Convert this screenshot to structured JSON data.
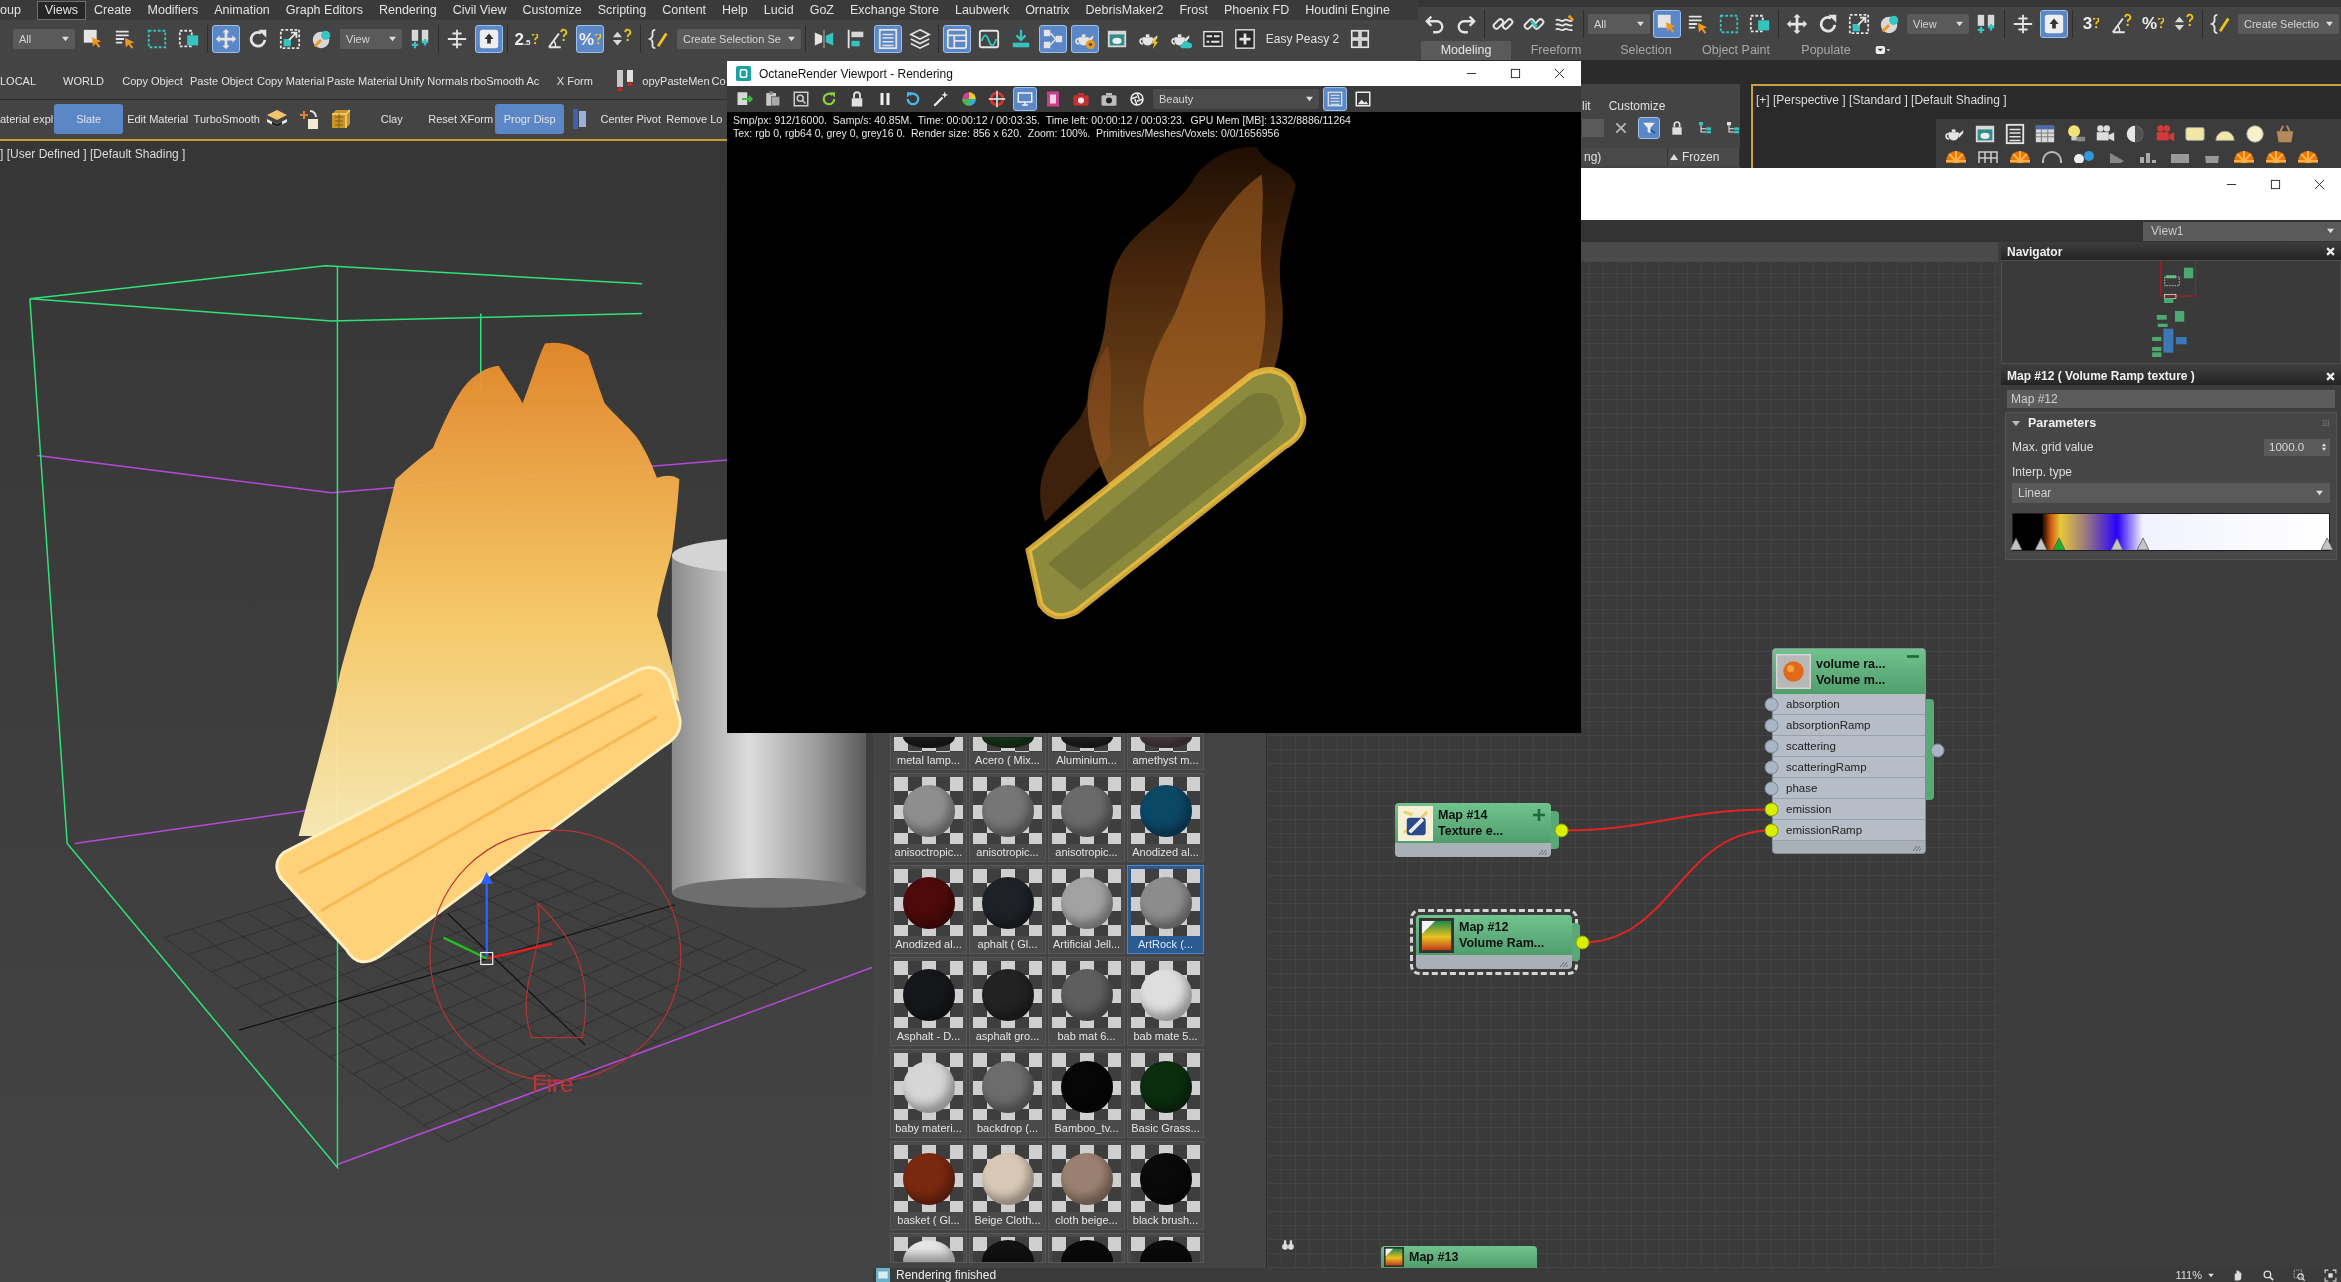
{
  "main_window": {
    "menu": [
      {
        "label": "oup",
        "selected": false
      },
      {
        "label": "Views",
        "selected": true
      },
      {
        "label": "Create",
        "selected": false
      },
      {
        "label": "Modifiers",
        "selected": false
      },
      {
        "label": "Animation",
        "selected": false
      },
      {
        "label": "Graph Editors",
        "selected": false
      },
      {
        "label": "Rendering",
        "selected": false
      },
      {
        "label": "Civil View",
        "selected": false
      },
      {
        "label": "Customize",
        "selected": false
      },
      {
        "label": "Scripting",
        "selected": false
      },
      {
        "label": "Content",
        "selected": false
      },
      {
        "label": "Help",
        "selected": false
      },
      {
        "label": "Lucid",
        "selected": false
      },
      {
        "label": "GoZ",
        "selected": false
      },
      {
        "label": "Exchange Store",
        "selected": false
      },
      {
        "label": "Laubwerk",
        "selected": false
      },
      {
        "label": "Ornatrix",
        "selected": false
      },
      {
        "label": "DebrisMaker2",
        "selected": false
      },
      {
        "label": "Frost",
        "selected": false
      },
      {
        "label": "Phoenix FD",
        "selected": false
      },
      {
        "label": "Houdini Engine",
        "selected": false
      }
    ],
    "toolbar": [
      [
        {
          "kind": "dropdown",
          "value": "All"
        },
        {
          "kind": "select",
          "on": false
        },
        {
          "kind": "select-name",
          "on": false
        },
        {
          "kind": "rect-region",
          "on": false
        },
        {
          "kind": "crossing",
          "on": false
        }
      ],
      [
        {
          "kind": "move",
          "on": true
        },
        {
          "kind": "rotate",
          "on": false
        },
        {
          "kind": "scale",
          "on": false
        },
        {
          "kind": "placement",
          "on": false
        },
        {
          "kind": "dropdown",
          "value": "View"
        },
        {
          "kind": "pivot",
          "on": false
        }
      ],
      [
        {
          "kind": "manipulate",
          "on": false
        },
        {
          "kind": "keyboard",
          "on": true
        }
      ],
      [
        {
          "kind": "snap",
          "label": "2$_{.5}$",
          "on": false
        },
        {
          "kind": "angle",
          "on": false
        },
        {
          "kind": "snap",
          "label": "%",
          "on": true
        },
        {
          "kind": "spinner",
          "on": false
        }
      ],
      [
        {
          "kind": "braces",
          "on": false
        },
        {
          "kind": "dropdown",
          "value": "Create Selection Se"
        }
      ],
      [
        {
          "kind": "mirror",
          "on": false
        },
        {
          "kind": "align",
          "on": false
        },
        {
          "kind": "table",
          "on": true
        },
        {
          "kind": "layers",
          "on": false
        }
      ],
      [
        {
          "kind": "panels",
          "on": true
        },
        {
          "kind": "curve",
          "on": false
        },
        {
          "kind": "download",
          "on": false
        },
        {
          "kind": "schematic",
          "on": true
        },
        {
          "kind": "teapot-gear",
          "on": true
        },
        {
          "kind": "render-window",
          "on": false
        },
        {
          "kind": "teapot-bolt",
          "on": false
        },
        {
          "kind": "teapot-cloud",
          "on": false
        },
        {
          "kind": "sliders",
          "on": false
        },
        {
          "kind": "plus-panel",
          "on": false
        },
        {
          "kind": "text",
          "label": "Easy Peasy 2"
        },
        {
          "kind": "quad",
          "on": false
        }
      ]
    ],
    "command_rows": [
      [
        {
          "kind": "button",
          "label": "LOCAL",
          "on": false
        },
        {
          "kind": "button",
          "label": "WORLD",
          "on": false
        },
        {
          "kind": "button",
          "label": "Copy Object",
          "on": false
        },
        {
          "kind": "button",
          "label": "Paste Object",
          "on": false
        },
        {
          "kind": "button",
          "label": "Copy Material",
          "on": false
        },
        {
          "kind": "button",
          "label": "Paste Material",
          "on": false
        },
        {
          "kind": "button",
          "label": "Unify Normals",
          "on": false
        },
        {
          "kind": "button",
          "label": "rboSmooth Ac",
          "on": false
        },
        {
          "kind": "button",
          "label": "X Form",
          "on": false
        },
        {
          "kind": "tags"
        },
        {
          "kind": "button",
          "label": "opyPasteMen",
          "on": false
        },
        {
          "kind": "button",
          "label": "Co",
          "on": false
        }
      ],
      [
        {
          "kind": "button",
          "label": "aterial expl",
          "on": false
        },
        {
          "kind": "button",
          "label": "Slate",
          "on": true
        },
        {
          "kind": "button",
          "label": "Edit Material",
          "on": false
        },
        {
          "kind": "button",
          "label": "TurboSmooth",
          "on": false
        },
        {
          "kind": "checker"
        },
        {
          "kind": "pivot-reset"
        },
        {
          "kind": "cube"
        },
        {
          "kind": "button",
          "label": "Clay",
          "on": false
        },
        {
          "kind": "button",
          "label": "Reset XForm",
          "on": false
        },
        {
          "kind": "button",
          "label": "Progr Disp",
          "on": true
        },
        {
          "kind": "split-panel"
        },
        {
          "kind": "button",
          "label": "Center Pivot",
          "on": false
        },
        {
          "kind": "button",
          "label": "Remove Lo",
          "on": false
        }
      ]
    ],
    "viewport": {
      "label": "] [User Defined ] [Default Shading ]",
      "active": true,
      "gizmo_label": "Fire"
    }
  },
  "octane_window": {
    "title": "OctaneRender Viewport - Rendering",
    "toolbar": [
      [
        {
          "kind": "o-export",
          "on": false
        },
        {
          "kind": "o-clipboard",
          "on": false
        },
        {
          "kind": "o-zoom",
          "on": false
        },
        {
          "kind": "o-restart",
          "on": false
        },
        {
          "kind": "lock",
          "on": false
        },
        {
          "kind": "pause",
          "on": false
        },
        {
          "kind": "o-reset",
          "on": false
        },
        {
          "kind": "wand",
          "on": false
        },
        {
          "kind": "wheel",
          "on": false
        },
        {
          "kind": "target",
          "on": false
        },
        {
          "kind": "monitor",
          "on": true
        },
        {
          "kind": "film",
          "on": false
        },
        {
          "kind": "cam-red",
          "on": false
        },
        {
          "kind": "cam",
          "on": false
        },
        {
          "kind": "aperture",
          "on": false
        },
        {
          "kind": "dropdown",
          "value": "Beauty"
        },
        {
          "kind": "list",
          "on": true
        },
        {
          "kind": "image",
          "on": false
        }
      ]
    ],
    "stats": [
      "Smp/px: 912/16000.  Samp/s: 40.85M.  Time: 00:00:12 / 00:03:35.  Time left: 00:00:12 / 00:03:23.  GPU Mem [MB]: 1332/8886/11264",
      "Tex: rgb 0, rgb64 0, grey 0, grey16 0.  Render size: 856 x 620.  Zoom: 100%.  Primitives/Meshes/Voxels: 0/0/1656956"
    ]
  },
  "scene_window": {
    "toolbar": [
      [
        {
          "kind": "undo",
          "on": false
        },
        {
          "kind": "redo",
          "on": false
        }
      ],
      [
        {
          "kind": "link",
          "on": false
        },
        {
          "kind": "unlink",
          "on": false
        },
        {
          "kind": "bind",
          "on": false
        }
      ],
      [
        {
          "kind": "dropdown",
          "value": "All"
        },
        {
          "kind": "select",
          "on": true
        },
        {
          "kind": "select-name",
          "on": false
        },
        {
          "kind": "rect-region",
          "on": false
        },
        {
          "kind": "crossing",
          "on": false
        }
      ],
      [
        {
          "kind": "move",
          "on": false
        },
        {
          "kind": "rotate",
          "on": false
        },
        {
          "kind": "scale",
          "on": false
        },
        {
          "kind": "placement",
          "on": false
        },
        {
          "kind": "dropdown",
          "value": "View"
        },
        {
          "kind": "pivot",
          "on": false
        }
      ],
      [
        {
          "kind": "manipulate",
          "on": false
        },
        {
          "kind": "keyboard",
          "on": true
        }
      ],
      [
        {
          "kind": "snap",
          "label": "3",
          "on": false
        },
        {
          "kind": "angle",
          "on": false
        },
        {
          "kind": "snap",
          "label": "%",
          "on": false
        },
        {
          "kind": "spinner",
          "on": false
        }
      ],
      [
        {
          "kind": "braces",
          "on": false
        },
        {
          "kind": "dropdown",
          "value": "Create Selectio"
        }
      ]
    ],
    "ribbon_tabs": [
      {
        "label": "Modeling",
        "selected": true
      },
      {
        "label": "Freeform",
        "selected": false
      },
      {
        "label": "Selection",
        "selected": false
      },
      {
        "label": "Object Paint",
        "selected": false
      },
      {
        "label": "Populate",
        "selected": false
      }
    ],
    "explorer": {
      "menu": [
        "lit",
        "Customize"
      ],
      "tools": [
        {
          "kind": "clear",
          "on": false
        },
        {
          "kind": "funnel",
          "on": true
        },
        {
          "kind": "lock",
          "on": false
        },
        {
          "kind": "hierarchy",
          "on": false
        },
        {
          "kind": "hierarchy2",
          "on": false
        }
      ],
      "columns": [
        {
          "label": "ng)",
          "sorted": false
        },
        {
          "label": "Frozen",
          "sorted": true
        }
      ]
    },
    "viewport": {
      "label": "[+] [Perspective ] [Standard ] [Default Shading ]",
      "active": true,
      "shelf": [
        {
          "kind": "teapot"
        },
        {
          "kind": "render-window"
        },
        {
          "kind": "table"
        },
        {
          "kind": "spreadsheet"
        },
        {
          "kind": "bulb"
        },
        {
          "kind": "movie-cam"
        },
        {
          "kind": "half"
        },
        {
          "kind": "movie-cam-red"
        },
        {
          "kind": "area-light"
        },
        {
          "kind": "dome"
        },
        {
          "kind": "sphere-light"
        },
        {
          "kind": "basket"
        }
      ],
      "shelf_row_2": [
        {
          "kind": "burst"
        },
        {
          "kind": "grid4"
        },
        {
          "kind": "burst"
        },
        {
          "kind": "ring"
        },
        {
          "kind": "dots"
        },
        {
          "kind": "play"
        },
        {
          "kind": "bars"
        },
        {
          "kind": "box"
        },
        {
          "kind": "bucket"
        },
        {
          "kind": "burst"
        },
        {
          "kind": "burst"
        },
        {
          "kind": "burst"
        }
      ]
    }
  },
  "slate_window": {
    "view": "View1",
    "materials": [
      {
        "label": "metal lamp...",
        "color": "#1c1c1c",
        "selected": false
      },
      {
        "label": "Acero  ( Mix...",
        "color": "#17361a",
        "selected": false
      },
      {
        "label": "Aluminium...",
        "color": "#202020",
        "selected": false
      },
      {
        "label": "amethyst m...",
        "color": "#4a3c42",
        "selected": false
      },
      {
        "label": "anisoctropic...",
        "color": "#8e8e8e",
        "selected": false
      },
      {
        "label": "anisotropic...",
        "color": "#767676",
        "selected": false
      },
      {
        "label": "anisotropic...",
        "color": "#6a6a6a",
        "selected": false
      },
      {
        "label": "Anodized al...",
        "color": "#0b4866",
        "selected": false
      },
      {
        "label": "Anodized al...",
        "color": "#4e0a0a",
        "selected": false
      },
      {
        "label": "aphalt  ( Gl...",
        "color": "#1e2226",
        "selected": false
      },
      {
        "label": "Artificial Jell...",
        "color": "#a2a2a2",
        "selected": false
      },
      {
        "label": "ArtRock  (...",
        "color": "#8c8c8c",
        "selected": true
      },
      {
        "label": "Asphalt - D...",
        "color": "#15171a",
        "selected": false
      },
      {
        "label": "asphalt gro...",
        "color": "#222222",
        "selected": false
      },
      {
        "label": "bab mat 6...",
        "color": "#5e5e5e",
        "selected": false
      },
      {
        "label": "bab mate 5...",
        "color": "#dedede",
        "selected": false
      },
      {
        "label": "baby materi...",
        "color": "#d6d6d6",
        "selected": false
      },
      {
        "label": "backdrop  (...",
        "color": "#6c6c6c",
        "selected": false
      },
      {
        "label": "Bamboo_tv...",
        "color": "#060606",
        "selected": false
      },
      {
        "label": "Basic Grass...",
        "color": "#0b2e0e",
        "selected": false
      },
      {
        "label": "basket  ( Gl...",
        "color": "#7a2810",
        "selected": false
      },
      {
        "label": "Beige Cloth...",
        "color": "#d8c8b6",
        "selected": false
      },
      {
        "label": "cloth beige...",
        "color": "#9a8070",
        "selected": false
      },
      {
        "label": "black brush...",
        "color": "#090909",
        "selected": false
      },
      {
        "color": "#e6e6e6",
        "selected": false
      },
      {
        "color": "#121212",
        "selected": false
      },
      {
        "color": "#0a0a0a",
        "selected": false
      },
      {
        "color": "#0a0a0a",
        "selected": false
      }
    ],
    "nodes": [
      {
        "kind": "texture",
        "title": "Map #14",
        "subtitle": "Texture  e...",
        "expanded": false,
        "selected": false,
        "linked": true
      },
      {
        "kind": "material",
        "title": "volume ra...",
        "subtitle": "Volume m...",
        "expanded": true,
        "selected": false,
        "linked": false,
        "slots": [
          {
            "label": "absorption",
            "connected": false
          },
          {
            "label": "absorptionRamp",
            "connected": false
          },
          {
            "label": "scattering",
            "connected": false
          },
          {
            "label": "scatteringRamp",
            "connected": false
          },
          {
            "label": "phase",
            "connected": false
          },
          {
            "label": "emission",
            "connected": true
          },
          {
            "label": "emissionRamp",
            "connected": true
          }
        ]
      },
      {
        "kind": "ramp",
        "title": "Map #12",
        "subtitle": "Volume  Ram...",
        "selected": true,
        "linked": true
      },
      {
        "kind": "ramp",
        "title": "Map #13",
        "selected": false
      }
    ],
    "navigator": {
      "title": "Navigator"
    },
    "parameters": {
      "title": "Map #12  ( Volume Ramp texture )",
      "name": "Map #12",
      "rollout": {
        "title": "Parameters",
        "expanded": true
      },
      "max_grid": {
        "label": "Max. grid value",
        "value": "1000.0"
      },
      "interp": {
        "label": "Interp. type",
        "value": "Linear"
      },
      "ramp_flags": [
        {
          "level": 0.01,
          "selected": false
        },
        {
          "level": 0.09,
          "selected": false
        },
        {
          "level": 0.146,
          "selected": true
        },
        {
          "level": 0.33,
          "selected": false
        },
        {
          "level": 0.41,
          "selected": false
        },
        {
          "level": 0.995,
          "selected": false
        }
      ]
    },
    "status": "Rendering finished",
    "zoom": "111%"
  }
}
